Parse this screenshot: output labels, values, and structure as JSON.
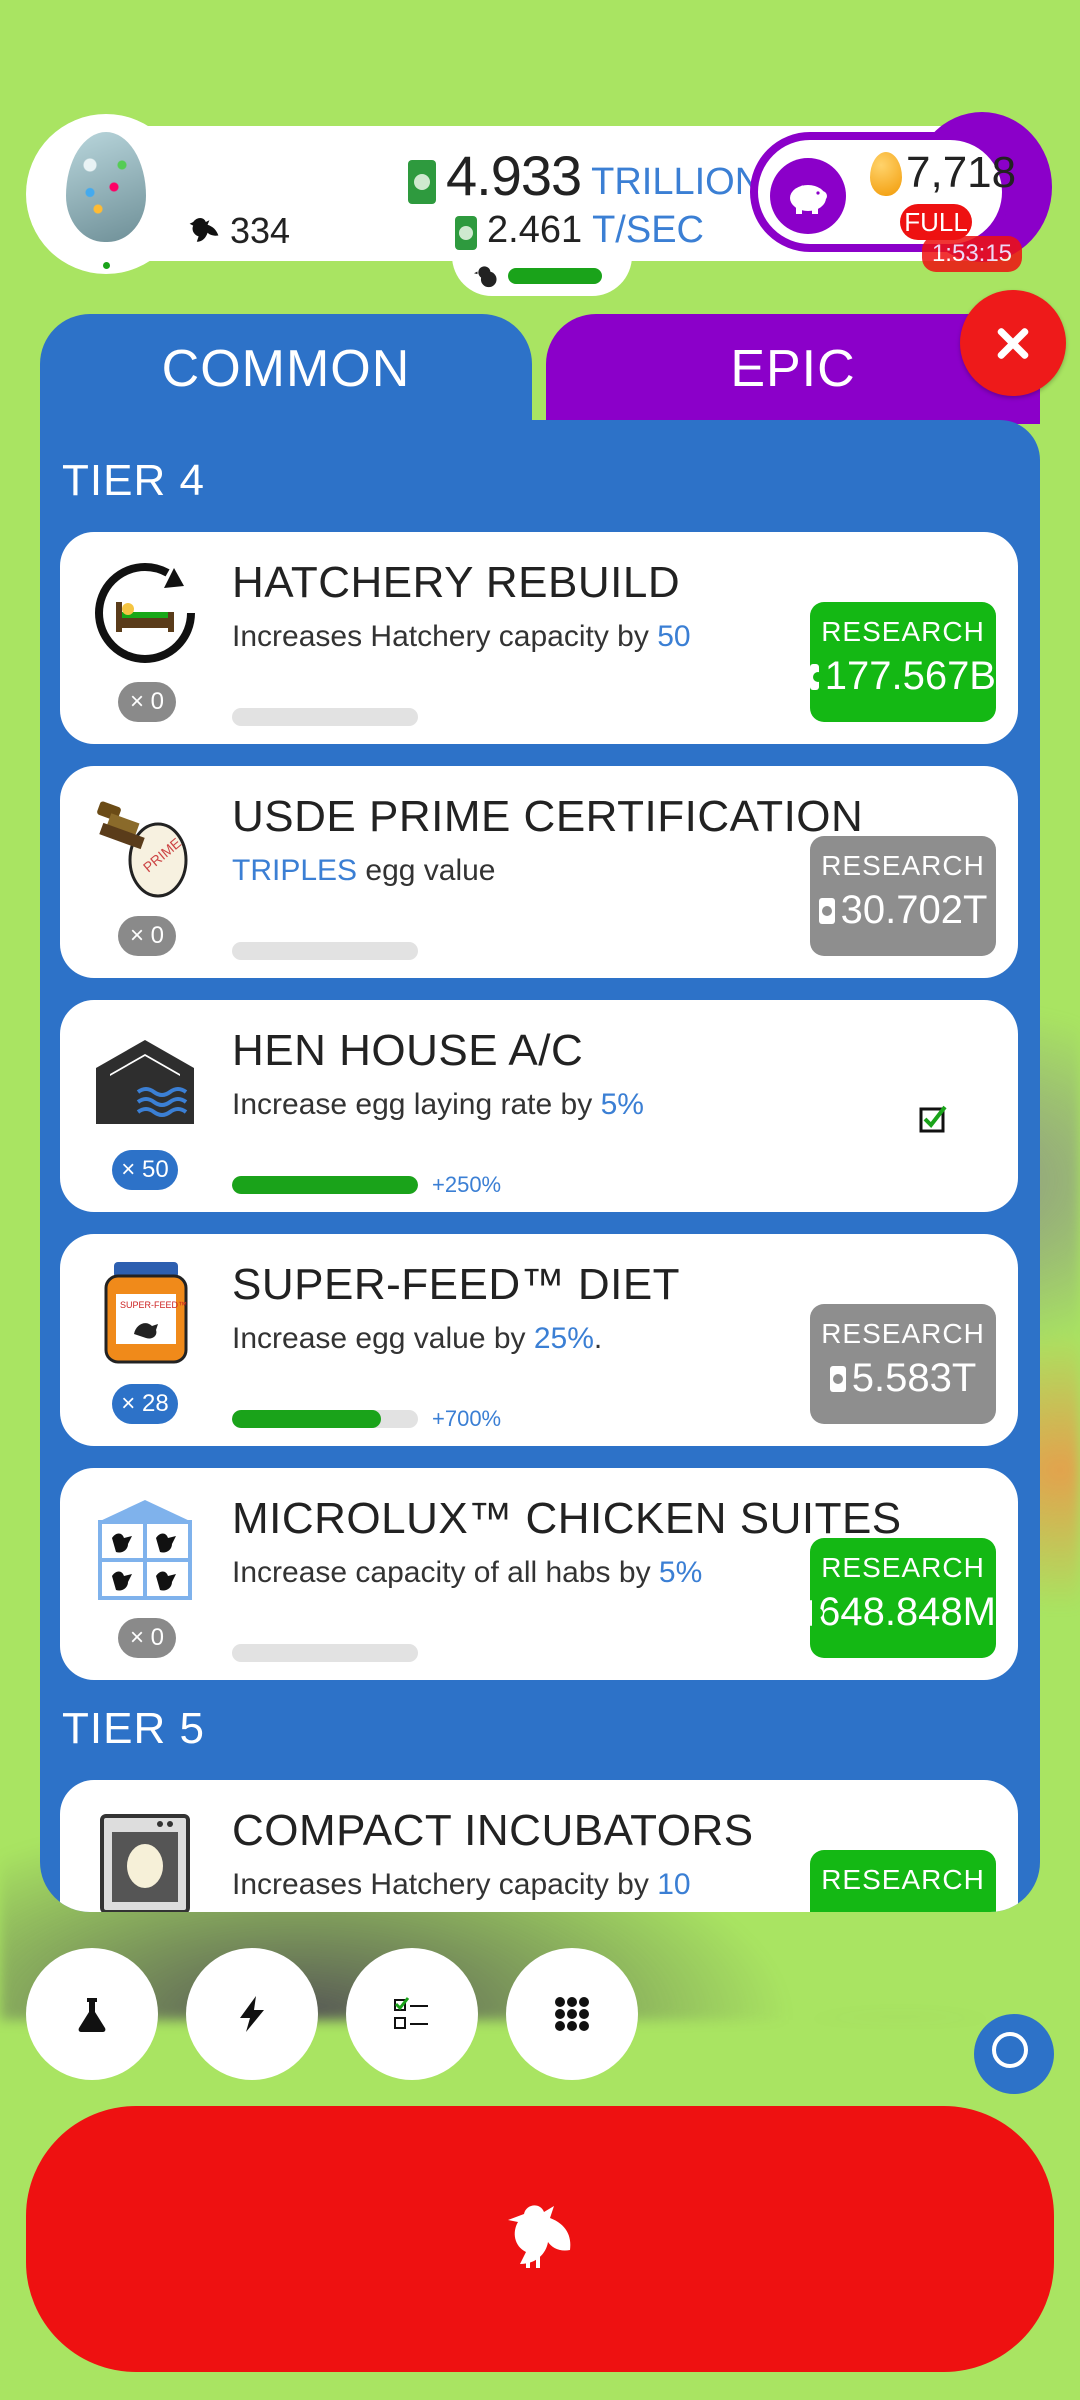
{
  "hud": {
    "chicken_count": "334",
    "money_value": "4.933",
    "money_unit": "TRILLION",
    "rate_value": "2.461",
    "rate_unit": "T/SEC",
    "golden_eggs": "7,718",
    "piggy_status": "FULL",
    "timer": "1:53:15"
  },
  "tabs": [
    {
      "label": "COMMON",
      "active": true
    },
    {
      "label": "EPIC",
      "active": false
    }
  ],
  "tiers": [
    {
      "label": "TIER 4",
      "items": [
        {
          "title": "HATCHERY REBUILD",
          "desc_pre": "Increases Hatchery capacity by ",
          "desc_hl": "50",
          "desc_post": "",
          "count": "× 0",
          "progress": 0,
          "progress_label": "",
          "button": {
            "label": "RESEARCH",
            "price": "177.567B",
            "state": "green"
          },
          "icon": "hatchery-rebuild-icon"
        },
        {
          "title": "USDE PRIME CERTIFICATION",
          "desc_pre": "",
          "desc_hl": "TRIPLES",
          "desc_post": " egg value",
          "count": "× 0",
          "progress": 0,
          "progress_label": "",
          "button": {
            "label": "RESEARCH",
            "price": "30.702T",
            "state": "gray"
          },
          "icon": "prime-stamp-icon"
        },
        {
          "title": "HEN HOUSE A/C",
          "desc_pre": "Increase egg laying rate by ",
          "desc_hl": "5%",
          "desc_post": "",
          "count": "× 50",
          "progress": 1.0,
          "progress_label": "+250%",
          "button": null,
          "icon": "hen-house-ac-icon"
        },
        {
          "title": "SUPER-FEED™ DIET",
          "desc_pre": "Increase egg value by ",
          "desc_hl": "25%",
          "desc_post": ".",
          "count": "× 28",
          "progress": 0.8,
          "progress_label": "+700%",
          "button": {
            "label": "RESEARCH",
            "price": "5.583T",
            "state": "gray"
          },
          "icon": "super-feed-jar-icon"
        },
        {
          "title": "MICROLUX™ CHICKEN SUITES",
          "desc_pre": "Increase capacity of all habs by ",
          "desc_hl": "5%",
          "desc_post": "",
          "count": "× 0",
          "progress": 0,
          "progress_label": "",
          "button": {
            "label": "RESEARCH",
            "price": "648.848M",
            "state": "green"
          },
          "icon": "chicken-suites-icon"
        }
      ]
    },
    {
      "label": "TIER 5",
      "items": [
        {
          "title": "COMPACT INCUBATORS",
          "desc_pre": "Increases Hatchery capacity by ",
          "desc_hl": "10",
          "desc_post": "",
          "count": "",
          "progress": 0,
          "progress_label": "",
          "button": {
            "label": "RESEARCH",
            "price": "",
            "state": "green"
          },
          "icon": "incubator-icon"
        }
      ]
    }
  ],
  "bottom_nav": [
    "research-flask-icon",
    "boost-lightning-icon",
    "checklist-icon",
    "grid-menu-icon"
  ],
  "colors": {
    "common": "#2d72c8",
    "epic": "#8b00c9",
    "research_ok": "#14b814",
    "research_locked": "#8e8e8e",
    "hatch": "#ee1111"
  }
}
